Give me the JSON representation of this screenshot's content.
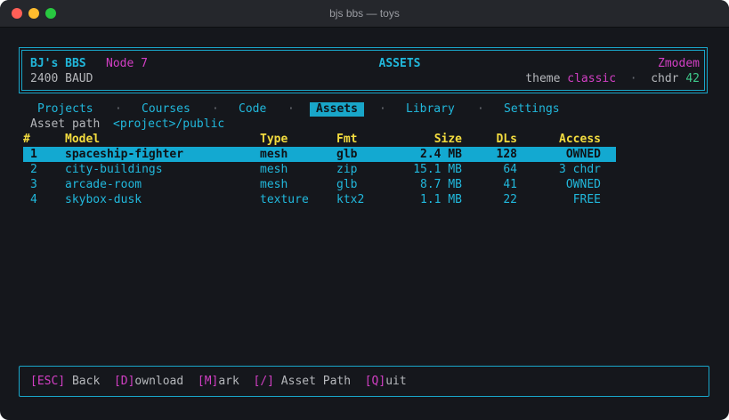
{
  "window": {
    "title": "bjs bbs — toys"
  },
  "header": {
    "bbs_name": "BJ's BBS",
    "node": "Node 7",
    "baud": "2400 BAUD",
    "section": "ASSETS",
    "protocol": "Zmodem",
    "theme_label": "theme",
    "theme_value": "classic",
    "separator": "·",
    "chdr_label": "chdr",
    "chdr_value": "42"
  },
  "tabs": [
    {
      "label": "Projects",
      "active": false
    },
    {
      "label": "Courses",
      "active": false
    },
    {
      "label": "Code",
      "active": false
    },
    {
      "label": "Assets",
      "active": true
    },
    {
      "label": "Library",
      "active": false
    },
    {
      "label": "Settings",
      "active": false
    }
  ],
  "tab_separator": "·",
  "asset_path": {
    "label": "Asset path",
    "value": "<project>/public"
  },
  "table": {
    "columns": [
      "#",
      "Model",
      "Type",
      "Fmt",
      "Size",
      "DLs",
      "Access"
    ],
    "rows": [
      {
        "num": "1",
        "model": "spaceship-fighter",
        "type": "mesh",
        "fmt": "glb",
        "size": "2.4 MB",
        "dls": "128",
        "access": "OWNED",
        "selected": true
      },
      {
        "num": "2",
        "model": "city-buildings",
        "type": "mesh",
        "fmt": "zip",
        "size": "15.1 MB",
        "dls": "64",
        "access": "3 chdr",
        "selected": false
      },
      {
        "num": "3",
        "model": "arcade-room",
        "type": "mesh",
        "fmt": "glb",
        "size": "8.7 MB",
        "dls": "41",
        "access": "OWNED",
        "selected": false
      },
      {
        "num": "4",
        "model": "skybox-dusk",
        "type": "texture",
        "fmt": "ktx2",
        "size": "1.1 MB",
        "dls": "22",
        "access": "FREE",
        "selected": false
      }
    ]
  },
  "footer": {
    "keys": [
      {
        "key": "[ESC]",
        "label": " Back"
      },
      {
        "key": "[D]",
        "label": "ownload"
      },
      {
        "key": "[M]",
        "label": "ark"
      },
      {
        "key": "[/]",
        "label": " Asset Path"
      },
      {
        "key": "[Q]",
        "label": "uit"
      }
    ]
  },
  "colors": {
    "accent": "#19a6c9",
    "magenta": "#d23fc4",
    "heading": "#f3dc3f",
    "chdr": "#3ec98a",
    "background": "#15171c"
  }
}
